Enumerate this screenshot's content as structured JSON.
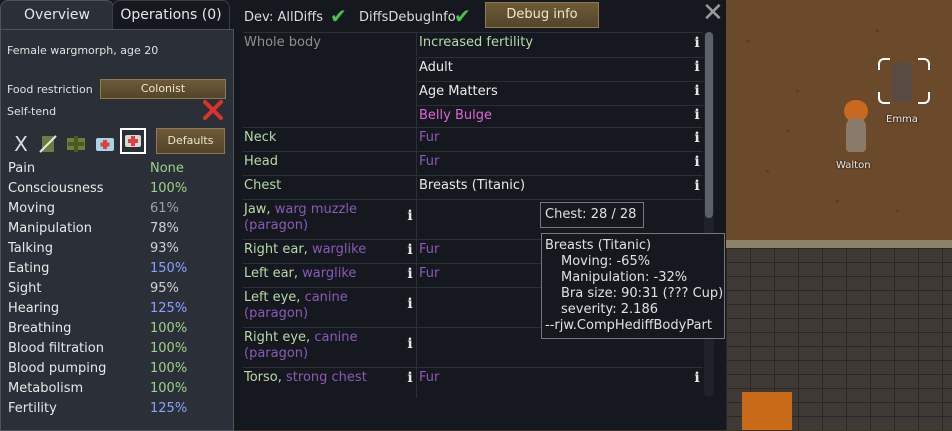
{
  "tabs": {
    "overview": "Overview",
    "operations": "Operations (0)"
  },
  "pawn": {
    "description": "Female wargmorph, age 20",
    "food_restriction_label": "Food restriction",
    "food_restriction_value": "Colonist",
    "self_tend_label": "Self-tend",
    "care_x": "X",
    "defaults_label": "Defaults"
  },
  "capacities": [
    {
      "label": "Pain",
      "value": "None",
      "color": "#9ed08a"
    },
    {
      "label": "Consciousness",
      "value": "100%",
      "color": "#9ed08a"
    },
    {
      "label": "Moving",
      "value": "61%",
      "color": "#a0a0a0"
    },
    {
      "label": "Manipulation",
      "value": "78%",
      "color": "#d0d0d0"
    },
    {
      "label": "Talking",
      "value": "93%",
      "color": "#d0d0d0"
    },
    {
      "label": "Eating",
      "value": "150%",
      "color": "#8aa0ff"
    },
    {
      "label": "Sight",
      "value": "95%",
      "color": "#d0d0d0"
    },
    {
      "label": "Hearing",
      "value": "125%",
      "color": "#8aa0ff"
    },
    {
      "label": "Breathing",
      "value": "100%",
      "color": "#9ed08a"
    },
    {
      "label": "Blood filtration",
      "value": "100%",
      "color": "#9ed08a"
    },
    {
      "label": "Blood pumping",
      "value": "100%",
      "color": "#9ed08a"
    },
    {
      "label": "Metabolism",
      "value": "100%",
      "color": "#9ed08a"
    },
    {
      "label": "Fertility",
      "value": "125%",
      "color": "#8aa0ff"
    }
  ],
  "dev": {
    "label": "Dev: AllDiffs",
    "debug_info_label": "DiffsDebugInfo",
    "debug_button": "Debug info"
  },
  "health": {
    "whole_body": "Whole body",
    "whole_body_hediffs": [
      "Increased fertility",
      "Adult",
      "Age Matters",
      "Belly Bulge"
    ],
    "neck": "Neck",
    "neck_hediff": "Fur",
    "head": "Head",
    "head_hediff": "Fur",
    "chest": "Chest",
    "chest_hediff": "Breasts (Titanic)",
    "jaw": "Jaw,",
    "jaw_mod": "warg muzzle",
    "jaw_mod2": "(paragon)",
    "right_ear": "Right ear,",
    "right_ear_mod": "warglike",
    "right_ear_hediff": "Fur",
    "left_ear": "Left ear,",
    "left_ear_mod": "warglike",
    "left_ear_hediff": "Fur",
    "left_eye": "Left eye,",
    "left_eye_mod": "canine",
    "left_eye_mod2": "(paragon)",
    "right_eye": "Right eye,",
    "right_eye_mod": "canine",
    "right_eye_mod2": "(paragon)",
    "torso": "Torso,",
    "torso_mod": "strong chest",
    "torso_hediff": "Fur",
    "info_glyph": "i"
  },
  "tooltip_small": "Chest:  28 / 28",
  "tooltip_big": [
    "Breasts (Titanic)",
    "Moving: -65%",
    "Manipulation: -32%",
    "Bra size: 90:31 (??? Cup)",
    "severity: 2.186",
    "--rjw.CompHediffBodyPart"
  ],
  "colonists": {
    "emma": "Emma",
    "walton": "Walton"
  },
  "colors": {
    "panel": "#2b3038",
    "button": "#6d5a38",
    "accent_green": "#4cc44c",
    "remove_red": "#e0302c"
  }
}
